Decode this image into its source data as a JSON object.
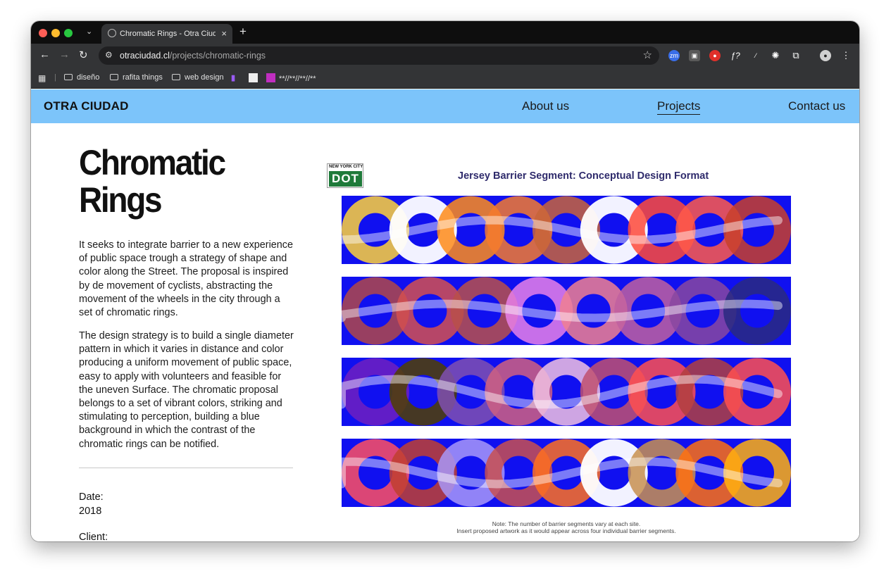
{
  "browser": {
    "tab_title": "Chromatic Rings - Otra Ciudad",
    "new_tab": "+",
    "tab_close": "×",
    "url_host": "otraciudad.cl",
    "url_path": "/projects/chromatic-rings",
    "bookmarks": [
      "diseño",
      "rafita things",
      "web design",
      "**//**//**//**"
    ]
  },
  "site": {
    "logo": "OTRA CIUDAD",
    "nav": [
      "About us",
      "Projects",
      "Contact us"
    ],
    "active_nav": "Projects"
  },
  "project": {
    "title_line1": "Chromatic",
    "title_line2": "Rings",
    "paragraph1": "It seeks to integrate barrier to a new experience of public space trough a strategy of shape and color along the Street. The proposal is inspired by de movement of cyclists, abstracting the movement of the wheels in the city through a set of chromatic rings.",
    "paragraph2": "The design strategy is to build a single diameter pattern in which it varies in distance and color producing a uniform movement of public space, easy to apply with volunteers and feasible for the uneven Surface. The chromatic proposal belongs to a set of vibrant colors, striking and stimulating to perception, building a blue background in which the contrast of the chromatic rings can be notified.",
    "date_label": "Date:",
    "date_value": "2018",
    "client_label": "Client:"
  },
  "artwork": {
    "logo_top": "NEW YORK CITY",
    "logo_main": "DOT",
    "title": "Jersey Barrier Segment: Conceptual Design Format",
    "note_line1": "Note: The number of barrier segments vary at each site.",
    "note_line2": "Insert proposed artwork as it would appear across four individual barrier segments.",
    "background_color": "#1010f0",
    "rows": [
      [
        "#ffd23a",
        "#ffffff",
        "#ff8c1a",
        "#f47a2e",
        "#c8643a",
        "#ffffff",
        "#ff4a3a",
        "#ff5a4a",
        "#c8402a"
      ],
      [
        "#b04848",
        "#d45050",
        "#b8504a",
        "#e880e8",
        "#f08090",
        "#c060a0",
        "#8848a0",
        "#2a2a80"
      ],
      [
        "#7020c0",
        "#504000",
        "#8050b0",
        "#d06080",
        "#f0c0e0",
        "#c05070",
        "#ff5050",
        "#b04040",
        "#ff5050"
      ],
      [
        "#ff5060",
        "#c04030",
        "#a898f8",
        "#c85050",
        "#ff7020",
        "#ffffff",
        "#c89050",
        "#ff7010",
        "#ffb010"
      ]
    ]
  }
}
